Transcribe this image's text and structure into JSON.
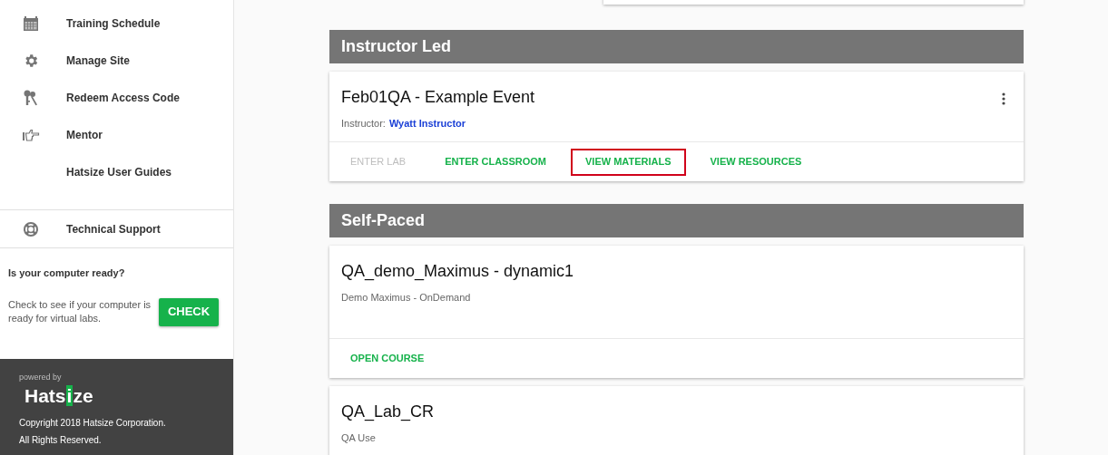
{
  "sidebar": {
    "items": [
      {
        "label": "Training Schedule"
      },
      {
        "label": "Manage Site"
      },
      {
        "label": "Redeem Access Code"
      },
      {
        "label": "Mentor"
      },
      {
        "label": "Hatsize User Guides"
      }
    ],
    "support": {
      "label": "Technical Support"
    },
    "readiness": {
      "title": "Is your computer ready?",
      "text": "Check to see if your computer is ready for virtual labs.",
      "button": "CHECK"
    },
    "footer": {
      "powered_by": "powered by",
      "logo": [
        "Hats",
        "i",
        "ze"
      ],
      "copyright": [
        "Copyright 2018 Hatsize Corporation.",
        "All Rights Reserved."
      ]
    }
  },
  "sections": [
    {
      "title": "Instructor Led",
      "cards": [
        {
          "title": "Feb01QA - Example Event",
          "menu": true,
          "instructor_label": "Instructor:",
          "instructor": "Wyatt Instructor",
          "actions": [
            {
              "label": "ENTER LAB",
              "disabled": true,
              "highlighted": false
            },
            {
              "label": "ENTER CLASSROOM",
              "disabled": false,
              "highlighted": false
            },
            {
              "label": "VIEW MATERIALS",
              "disabled": false,
              "highlighted": true
            },
            {
              "label": "VIEW RESOURCES",
              "disabled": false,
              "highlighted": false
            }
          ]
        }
      ]
    },
    {
      "title": "Self-Paced",
      "cards": [
        {
          "title": "QA_demo_Maximus - dynamic1",
          "menu": false,
          "subtitle": "Demo Maximus - OnDemand",
          "actions": [
            {
              "label": "OPEN COURSE",
              "disabled": false,
              "highlighted": false
            }
          ]
        },
        {
          "title": "QA_Lab_CR",
          "menu": false,
          "subtitle": "QA Use"
        }
      ]
    }
  ]
}
